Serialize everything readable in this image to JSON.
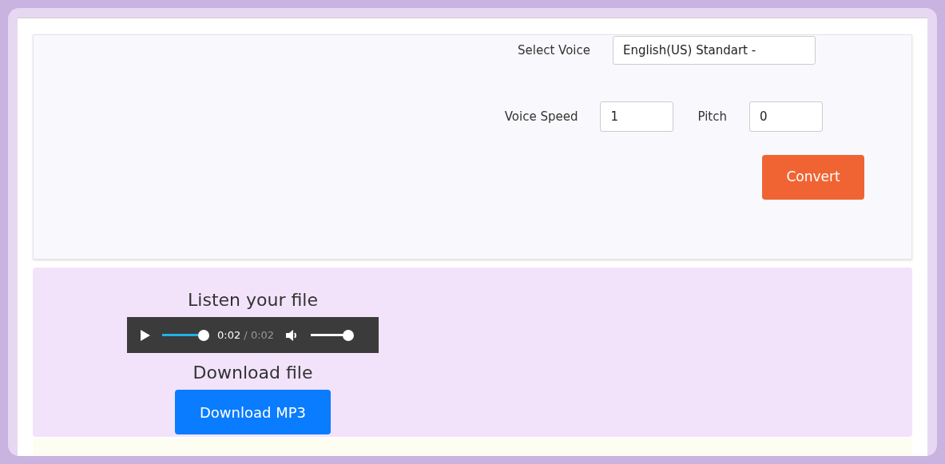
{
  "voice_form": {
    "select_voice": {
      "label": "Select Voice",
      "value": "English(US) Standart -"
    },
    "voice_speed": {
      "label": "Voice Speed",
      "value": "1"
    },
    "pitch": {
      "label": "Pitch",
      "value": "0"
    },
    "convert_button": "Convert"
  },
  "result": {
    "listen_heading": "Listen your file",
    "player": {
      "level": 1,
      "current_time": "0:02",
      "separator": "/",
      "duration": "0:02",
      "volume": {
        "level": 1
      }
    },
    "download_heading": "Download file",
    "download_button": "Download MP3"
  }
}
